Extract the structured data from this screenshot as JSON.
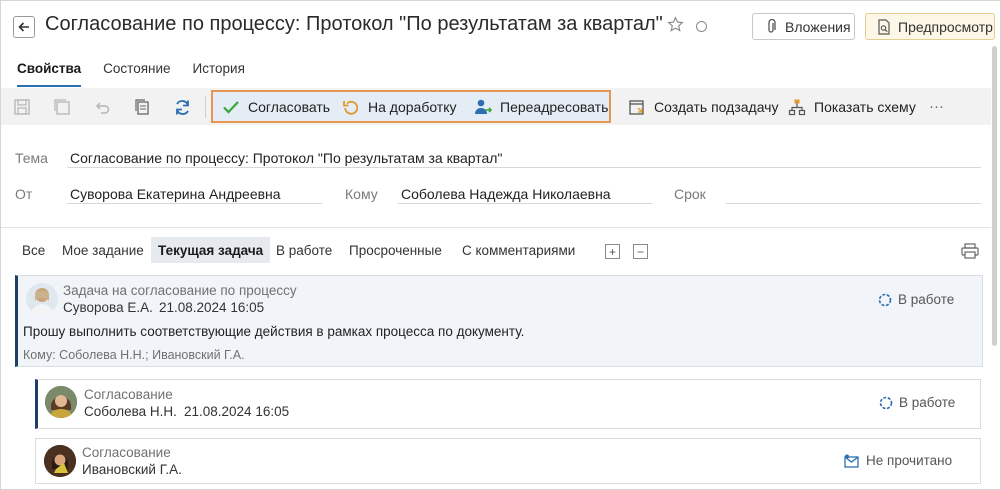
{
  "header": {
    "title": "Согласование по процессу: Протокол \"По результатам за квартал\"",
    "attachments_label": "Вложения",
    "preview_label": "Предпросмотр"
  },
  "tabs": [
    {
      "label": "Свойства",
      "active": true
    },
    {
      "label": "Состояние",
      "active": false
    },
    {
      "label": "История",
      "active": false
    }
  ],
  "toolbar": {
    "approve_label": "Согласовать",
    "rework_label": "На доработку",
    "redirect_label": "Переадресовать",
    "subtask_label": "Создать подзадачу",
    "scheme_label": "Показать схему",
    "more_label": "···"
  },
  "form": {
    "subject_label": "Тема",
    "subject_value": "Согласование по процессу: Протокол \"По результатам за квартал\"",
    "from_label": "От",
    "from_value": "Суворова Екатерина Андреевна",
    "to_label": "Кому",
    "to_value": "Соболева Надежда Николаевна",
    "deadline_label": "Срок",
    "deadline_value": ""
  },
  "filters": [
    {
      "label": "Все",
      "active": false
    },
    {
      "label": "Мое задание",
      "active": false
    },
    {
      "label": "Текущая задача",
      "active": true
    },
    {
      "label": "В работе",
      "active": false
    },
    {
      "label": "Просроченные",
      "active": false
    },
    {
      "label": "С комментариями",
      "active": false
    }
  ],
  "tasks": [
    {
      "title": "Задача на согласование по процессу",
      "author": "Суворова Е.А.",
      "date": "21.08.2024 16:05",
      "status": "В работе",
      "body": "Прошу выполнить соответствующие действия в рамках процесса по документу.",
      "recipients": "Кому: Соболева Н.Н.; Ивановский Г.А."
    },
    {
      "title": "Согласование",
      "author": "Соболева Н.Н.",
      "date": "21.08.2024 16:05",
      "status": "В работе"
    },
    {
      "title": "Согласование",
      "author": "Ивановский Г.А.",
      "date": "",
      "status": "Не прочитано"
    }
  ],
  "colors": {
    "accent": "#2c6fb0",
    "highlight_border": "#e8964f",
    "card_edge": "#1e3f66",
    "approve_green": "#3aa53a",
    "rework_orange": "#e0982c"
  }
}
